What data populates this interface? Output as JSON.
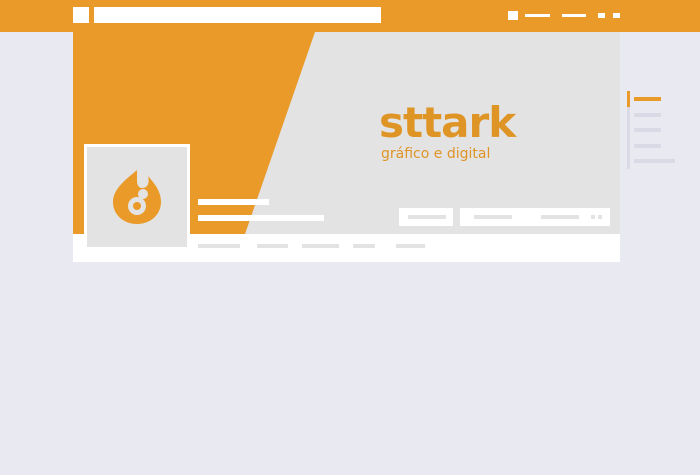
{
  "colors": {
    "accent": "#e99a28",
    "brand_text": "#df9426",
    "cover_grey": "#e3e3e3",
    "placeholder": "#dadae6",
    "background": "#e9e9f2"
  },
  "topbar": {
    "search_icon": "search-icon",
    "menu_icons": [
      "home-icon",
      "profile-icon",
      "friends-icon",
      "notifications-icon",
      "messages-icon"
    ]
  },
  "cover": {
    "brand_name": "sttark",
    "brand_tagline": "gráfico e digital",
    "logo_icon": "flame-logo-icon"
  },
  "profile": {
    "avatar_icon": "flame-logo-icon"
  }
}
